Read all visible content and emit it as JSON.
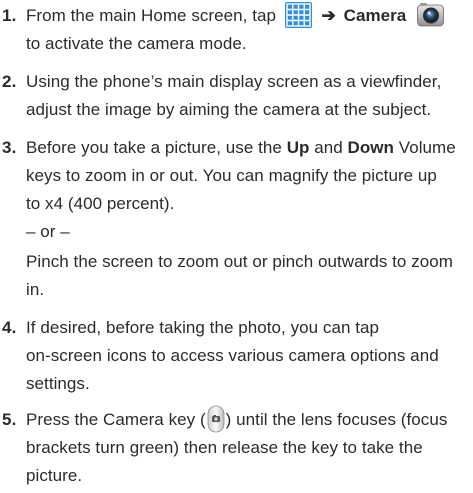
{
  "steps": [
    {
      "number": "1.",
      "lines": {
        "l1_before": "From the main Home screen, tap",
        "l1_arrow": "➔",
        "l1_bold": "Camera",
        "l2": "to activate the camera mode."
      }
    },
    {
      "number": "2.",
      "lines": {
        "l1": "Using the phone’s main display screen as a viewfinder,",
        "l2": "adjust the image by aiming the camera at the subject."
      }
    },
    {
      "number": "3.",
      "lines": {
        "l1_a": "Before you take a picture, use the ",
        "l1_b": "Up",
        "l1_c": " and ",
        "l1_d": "Down",
        "l1_e": " Volume",
        "l2": "keys to zoom in or out. You can magnify the picture up",
        "l3": "to x4 (400 percent).",
        "or": "– or –",
        "l4": "Pinch the screen to zoom out or pinch outwards to zoom",
        "l5": "in."
      }
    },
    {
      "number": "4.",
      "lines": {
        "l1": "If desired, before taking the photo, you can tap",
        "l2": "on-screen icons to access various camera options and",
        "l3": "settings."
      }
    },
    {
      "number": "5.",
      "lines": {
        "l1_a": "Press the Camera key (",
        "l1_b": ") until the lens focuses (focus",
        "l2": "brackets turn green) then release the key to take the",
        "l3": "picture."
      }
    }
  ],
  "icons": {
    "apps": "apps-grid-icon",
    "camera": "camera-app-icon",
    "camera_key": "camera-key-icon"
  },
  "colors": {
    "text": "#2b2b2b",
    "apps_icon_fill": "#2f8fde",
    "apps_icon_grid": "#ffffff"
  }
}
